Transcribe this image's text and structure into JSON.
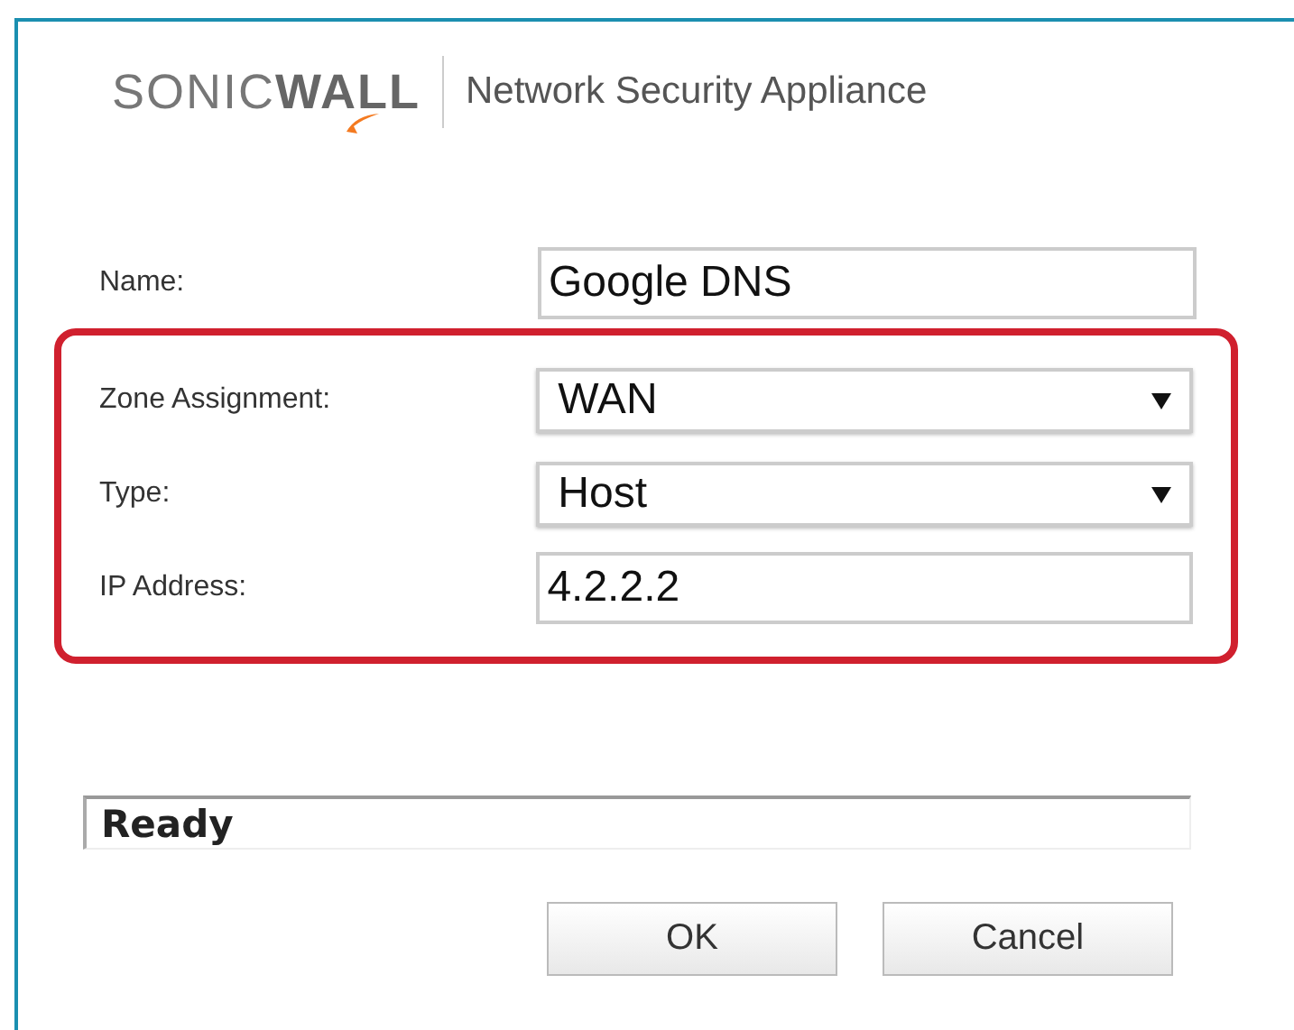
{
  "header": {
    "logo": "SONIC**WALL**",
    "product": "Network Security Appliance"
  },
  "fields": [
    {
      "label": "Name:",
      "kind": "text",
      "value": "Google DNS",
      "highlighted": false
    },
    {
      "label": "Zone Assignment:",
      "kind": "select",
      "value": "WAN",
      "highlighted": true
    },
    {
      "label": "Type:",
      "kind": "select",
      "value": "Host",
      "highlighted": true
    },
    {
      "label": "IP Address:",
      "kind": "text",
      "value": "4.2.2.2",
      "highlighted": true
    }
  ],
  "status": "Ready",
  "buttons": [
    "OK",
    "Cancel"
  ]
}
